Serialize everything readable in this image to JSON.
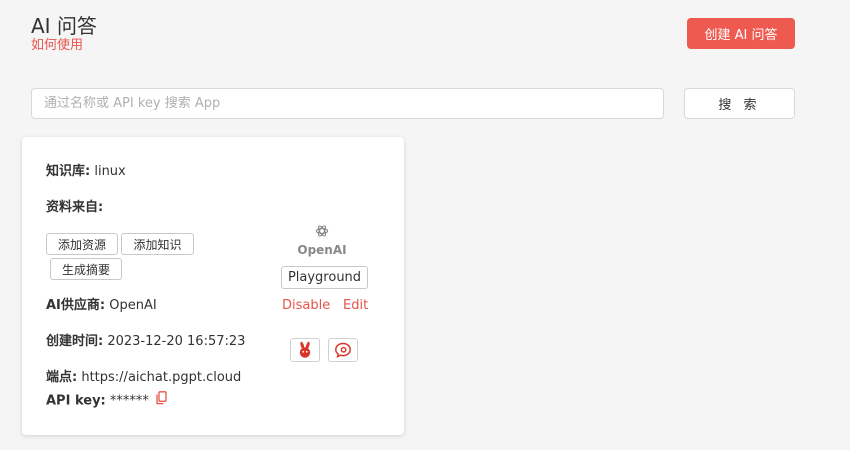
{
  "header": {
    "title": "AI 问答",
    "help_link": "如何使用",
    "create_button": "创建 AI 问答"
  },
  "search": {
    "placeholder": "通过名称或 API key 搜索 App",
    "value": "",
    "button": "搜 索"
  },
  "card": {
    "knowledge_base_label": "知识库:",
    "knowledge_base_value": "linux",
    "source_label": "资料来自:",
    "tags": [
      "添加资源",
      "添加知识",
      "生成摘要"
    ],
    "provider_label": "AI供应商:",
    "provider_value": "OpenAI",
    "created_label": "创建时间:",
    "created_value": "2023-12-20 16:57:23",
    "endpoint_label": "端点:",
    "endpoint_value": "https://aichat.pgpt.cloud",
    "api_key_label": "API key:",
    "api_key_value": "******",
    "logo_text": "OpenAI",
    "playground_button": "Playground",
    "disable_link": "Disable",
    "edit_link": "Edit"
  },
  "colors": {
    "accent": "#ef5a50",
    "link": "#e8534a",
    "background": "#f5f5f5"
  },
  "icons": {
    "copy": "copy-icon",
    "provider_logo": "openai-logo-icon",
    "integration_1": "rabbit-bot-icon",
    "integration_2": "chat-bubble-icon"
  }
}
